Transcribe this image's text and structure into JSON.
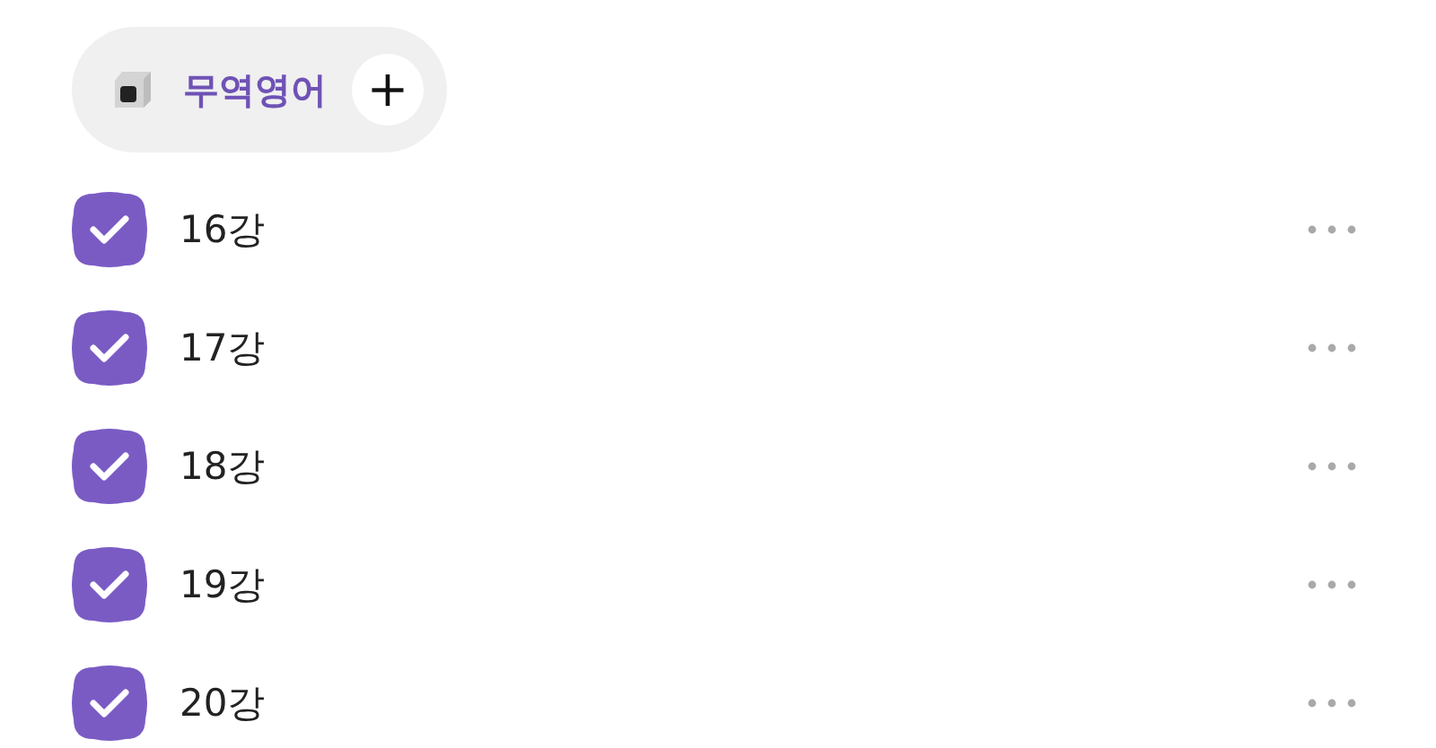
{
  "tag": {
    "label": "무역영어",
    "add_button": "+"
  },
  "tasks": [
    {
      "title": "16강",
      "checked": true
    },
    {
      "title": "17강",
      "checked": true
    },
    {
      "title": "18강",
      "checked": true
    },
    {
      "title": "19강",
      "checked": true
    },
    {
      "title": "20강",
      "checked": true
    }
  ]
}
